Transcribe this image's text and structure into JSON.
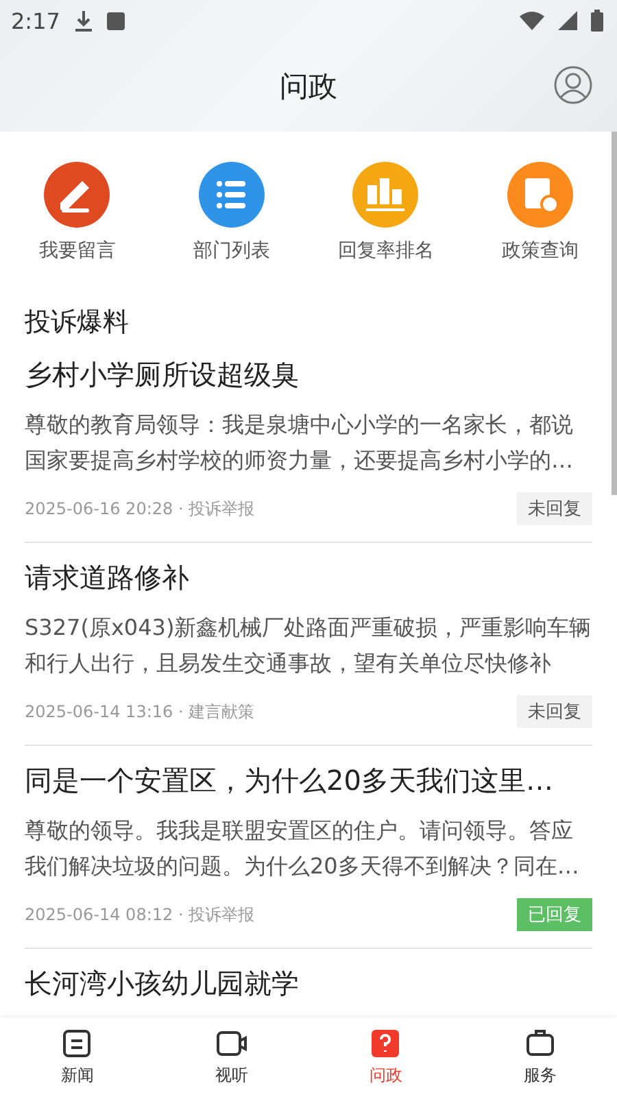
{
  "status_bar": {
    "time": "2:17"
  },
  "header": {
    "title": "问政"
  },
  "shortcuts": [
    {
      "label": "我要留言",
      "kind": "write",
      "color": "#e04a21"
    },
    {
      "label": "部门列表",
      "kind": "list",
      "color": "#2f94e8"
    },
    {
      "label": "回复率排名",
      "kind": "rank",
      "color": "#f5a712"
    },
    {
      "label": "政策查询",
      "kind": "policy",
      "color": "#fb8a1c"
    }
  ],
  "section": {
    "title": "投诉爆料"
  },
  "posts": [
    {
      "title": "乡村小学厕所设超级臭",
      "body": "尊敬的教育局领导：我是泉塘中心小学的一名家长，都说国家要提高乡村学校的师资力量，还要提高乡村小学的…",
      "meta": "2025-06-16 20:28 · 投诉举报",
      "status": "未回复",
      "replied": false
    },
    {
      "title": "请求道路修补",
      "body": "S327(原x043)新鑫机械厂处路面严重破损，严重影响车辆和行人出行，且易发生交通事故，望有关单位尽快修补",
      "meta": "2025-06-14 13:16 · 建言献策",
      "status": "未回复",
      "replied": false
    },
    {
      "title": "同是一个安置区，为什么20多天我们这里…",
      "body": "尊敬的领导。我我是联盟安置区的住户。请问领导。答应我们解决垃圾的问题。为什么20多天得不到解决？同在…",
      "meta": "2025-06-14 08:12 · 投诉举报",
      "status": "已回复",
      "replied": true
    },
    {
      "title": "长河湾小孩幼儿园就学"
    }
  ],
  "bottom_nav": [
    {
      "label": "新闻",
      "kind": "news",
      "selected": false
    },
    {
      "label": "视听",
      "kind": "video",
      "selected": false
    },
    {
      "label": "问政",
      "kind": "ask",
      "selected": true
    },
    {
      "label": "服务",
      "kind": "service",
      "selected": false
    }
  ]
}
